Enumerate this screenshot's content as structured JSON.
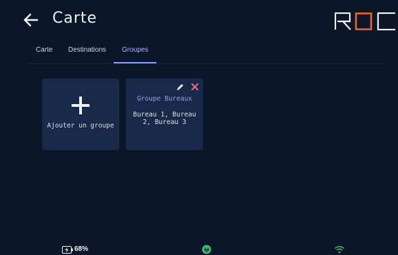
{
  "header": {
    "title": "Carte",
    "logo_text": "ROC"
  },
  "tabs": [
    {
      "label": "Carte",
      "active": false
    },
    {
      "label": "Destinations",
      "active": false
    },
    {
      "label": "Groupes",
      "active": true
    }
  ],
  "add_group": {
    "label": "Ajouter un groupe"
  },
  "groups": [
    {
      "name": "Groupe Bureaux",
      "members": "Bureau 1, Bureau 2, Bureau 3"
    }
  ],
  "status": {
    "battery": "68%"
  },
  "colors": {
    "background": "#0b1628",
    "card": "#19294a",
    "accent": "#8c9cff",
    "logo_accent": "#e8662c",
    "close": "#f06478",
    "status_ok": "#3fc070"
  },
  "icons": [
    "back-arrow-icon",
    "roc-logo",
    "plus-icon",
    "pencil-icon",
    "close-icon",
    "battery-charging-icon",
    "plug-icon",
    "wifi-icon"
  ]
}
